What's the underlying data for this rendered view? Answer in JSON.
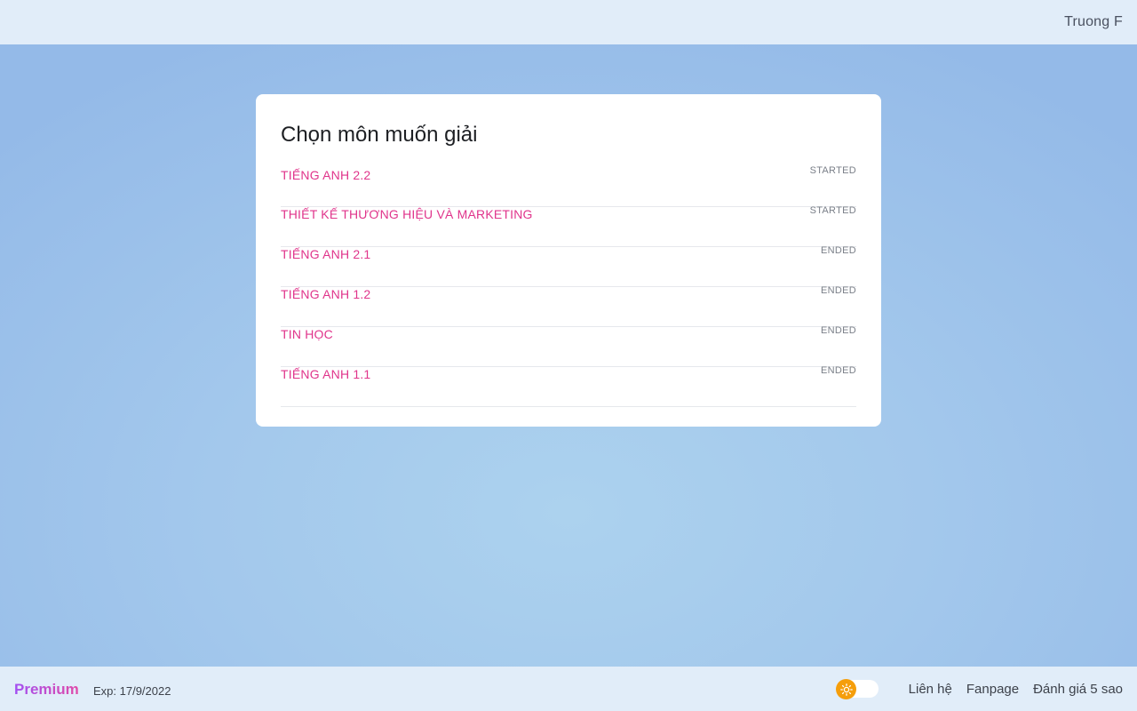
{
  "header": {
    "user_name": "Truong F"
  },
  "main": {
    "title": "Chọn môn muốn giải",
    "courses": [
      {
        "name": "TIẾNG ANH 2.2",
        "status": "STARTED"
      },
      {
        "name": "THIẾT KẾ THƯƠNG HIỆU VÀ MARKETING",
        "status": "STARTED"
      },
      {
        "name": "TIẾNG ANH 2.1",
        "status": "ENDED"
      },
      {
        "name": "TIẾNG ANH 1.2",
        "status": "ENDED"
      },
      {
        "name": "TIN HỌC",
        "status": "ENDED"
      },
      {
        "name": "TIẾNG ANH 1.1",
        "status": "ENDED"
      }
    ]
  },
  "footer": {
    "premium_label": "Premium",
    "expiry": "Exp: 17/9/2022",
    "theme_toggle_icon": "sun-icon",
    "links": {
      "contact": "Liên hệ",
      "fanpage": "Fanpage",
      "rate": "Đánh giá 5 sao"
    }
  },
  "colors": {
    "accent": "#e0348b",
    "toggle": "#f59e0b",
    "bar_background": "#e1edf9"
  }
}
